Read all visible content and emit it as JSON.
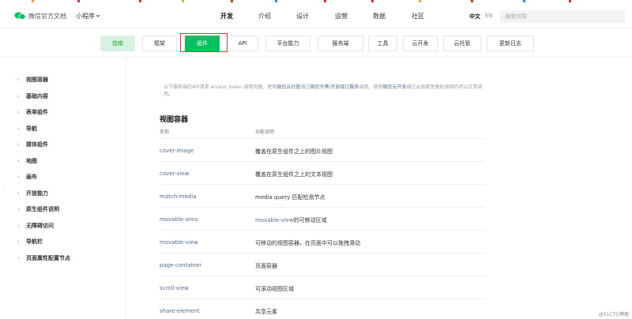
{
  "header": {
    "site_title": "微信官方文档",
    "site_sep": "·",
    "site_sub": "小程序",
    "nav": [
      "开发",
      "介绍",
      "设计",
      "运营",
      "数据",
      "社区"
    ],
    "active_nav": "开发",
    "lang_zh": "中文",
    "lang_en": "EN",
    "search_placeholder": "搜索内容"
  },
  "tabs": [
    "指南",
    "框架",
    "组件",
    "API",
    "平台能力",
    "服务端",
    "工具",
    "云开发",
    "云托管",
    "更新日志"
  ],
  "active_tab": "组件",
  "sidebar": {
    "items": [
      "视图容器",
      "基础内容",
      "表单组件",
      "导航",
      "媒体组件",
      "地图",
      "画布",
      "开放能力",
      "原生组件说明",
      "无障碍访问",
      "导航栏",
      "页面属性配置节点"
    ]
  },
  "content": {
    "desc_pre": "以下服务端的API请求 access_token 调用凭据，使用",
    "desc_link1": "微信云托管",
    "desc_mid1": "通过",
    "desc_link2": "微信令牌/开放接口服务",
    "desc_mid2": "调用，使用",
    "desc_link3": "微信云开发",
    "desc_post": "通过云函数免鉴权调用仍可以正常调用。",
    "section_title": "视图容器",
    "col_name": "名称",
    "col_desc": "功能说明",
    "rows": [
      {
        "name": "cover-image",
        "desc": "覆盖在原生组件之上的图片视图"
      },
      {
        "name": "cover-view",
        "desc": "覆盖在原生组件之上的文本视图"
      },
      {
        "name": "match-media",
        "desc": "media query 匹配检测节点"
      },
      {
        "name": "movable-area",
        "desc_link": "movable-view",
        "desc": "的可移动区域"
      },
      {
        "name": "movable-view",
        "desc": "可移动的视图容器，在页面中可以拖拽滑动"
      },
      {
        "name": "page-container",
        "desc": "页面容器"
      },
      {
        "name": "scroll-view",
        "desc": "可滚动视图区域"
      },
      {
        "name": "share-element",
        "desc": "共享元素"
      }
    ]
  },
  "watermark": "@51CTO博客",
  "colors": {
    "brand": "#07c160",
    "link": "#576b95",
    "highlight": "#e53935"
  }
}
